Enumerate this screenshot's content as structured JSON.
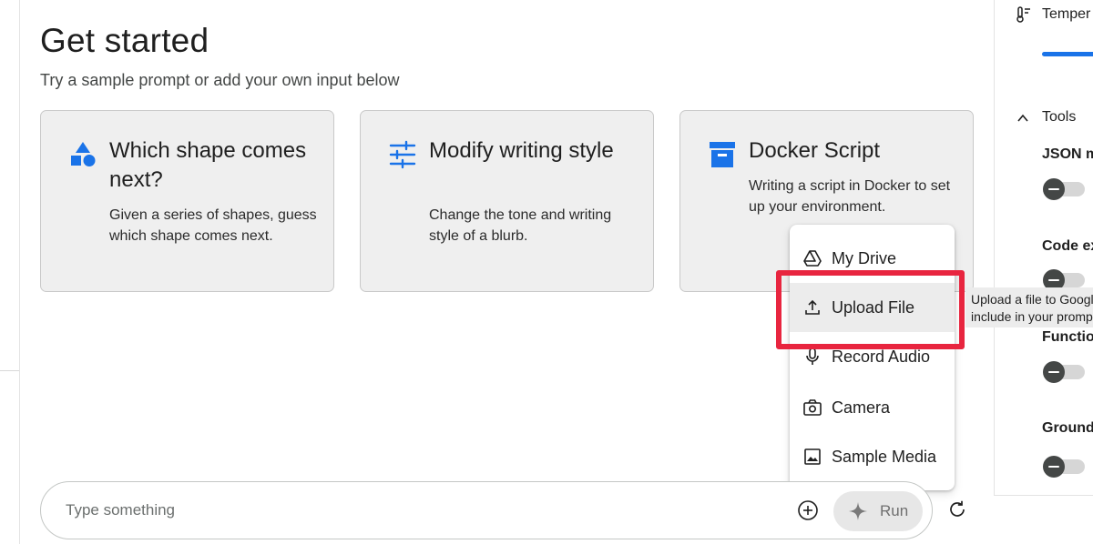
{
  "header": {
    "title": "Get started",
    "subtitle": "Try a sample prompt or add your own input below"
  },
  "cards": [
    {
      "title": "Which shape comes next?",
      "description": "Given a series of shapes, guess which shape comes next.",
      "icon": "shapes-icon"
    },
    {
      "title": "Modify writing style",
      "description": "Change the tone and writing style of a blurb.",
      "icon": "tune-icon"
    },
    {
      "title": "Docker Script",
      "description": "Writing a script in Docker to set up your environment.",
      "icon": "archive-box-icon"
    }
  ],
  "upload_menu": {
    "items": [
      {
        "label": "My Drive",
        "icon": "google-drive-icon"
      },
      {
        "label": "Upload File",
        "icon": "upload-icon"
      },
      {
        "label": "Record Audio",
        "icon": "microphone-icon"
      },
      {
        "label": "Camera",
        "icon": "camera-icon"
      },
      {
        "label": "Sample Media",
        "icon": "image-icon"
      }
    ],
    "highlighted_item": "Upload File"
  },
  "tooltip": {
    "line1": "Upload a file to Googl",
    "line2": "include in your promp"
  },
  "prompt": {
    "placeholder": "Type something",
    "value": "",
    "run_label": "Run"
  },
  "settings_panel": {
    "temperature_label": "Temper",
    "tools_label": "Tools",
    "tools": [
      {
        "label": "JSON m",
        "enabled": false
      },
      {
        "label": "Code ex",
        "enabled": false
      },
      {
        "label": "Functio",
        "enabled": false
      },
      {
        "label": "Ground",
        "enabled": false
      }
    ]
  },
  "colors": {
    "accent": "#1a73e8",
    "highlight": "#e8253f",
    "card_bg": "#efefef"
  }
}
